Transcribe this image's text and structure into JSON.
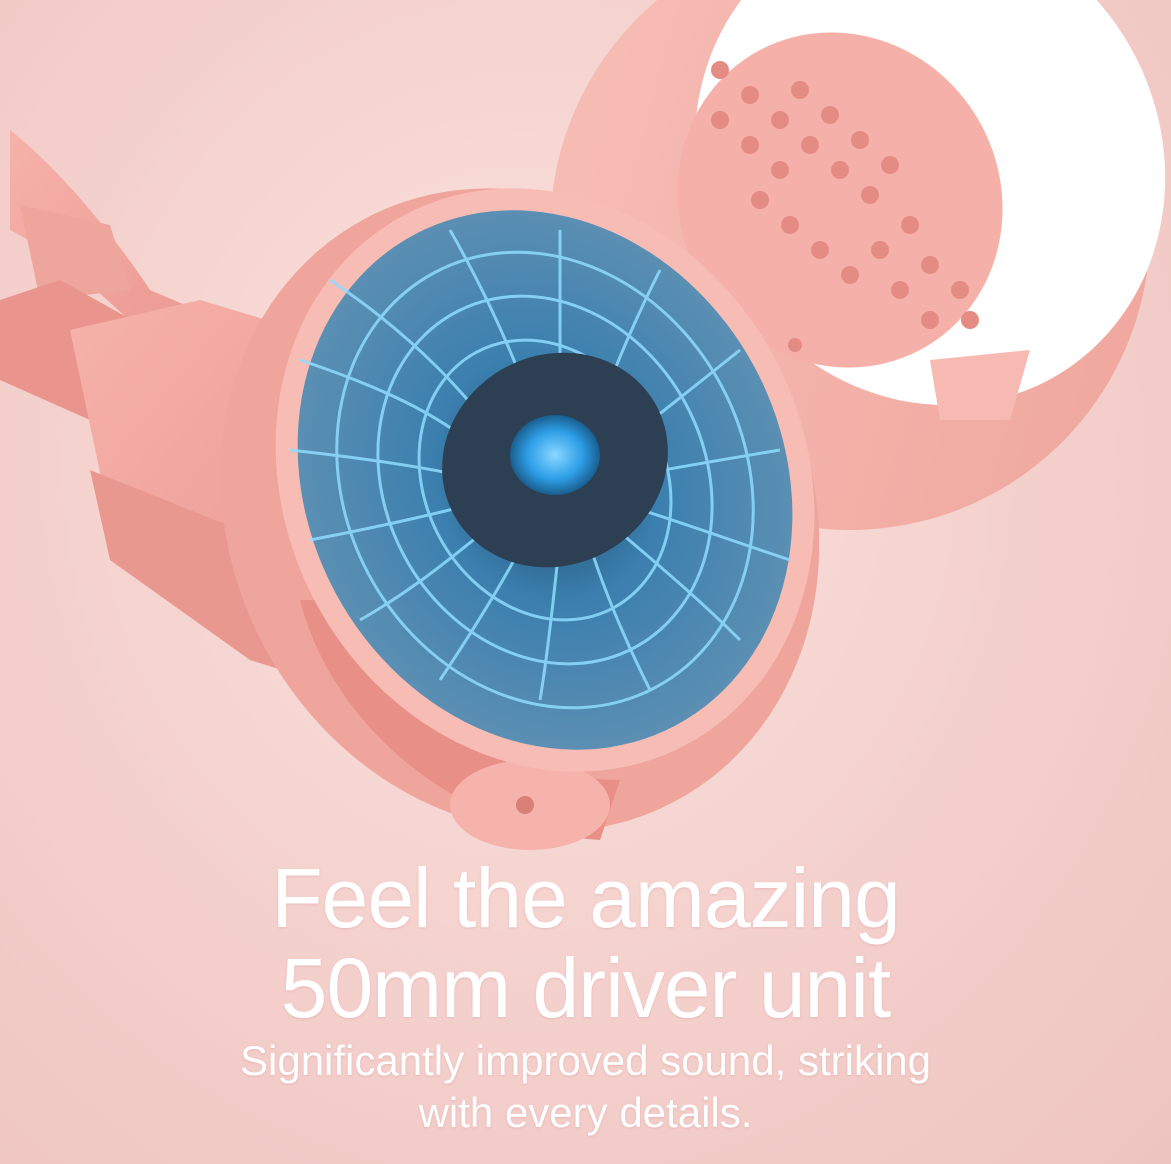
{
  "headline": {
    "line1": "Feel the amazing",
    "line2": "50mm driver unit"
  },
  "subtext": {
    "line1": "Significantly improved sound, striking",
    "line2": "with every details."
  },
  "colors": {
    "background": "#f4d0cc",
    "shell": "#f2a89f",
    "shell_shadow": "#dd8d86",
    "driver_blue": "#3f8fc4",
    "accent_glow": "#4ab8ff",
    "cushion": "#ffffff",
    "text": "#ffffff"
  }
}
